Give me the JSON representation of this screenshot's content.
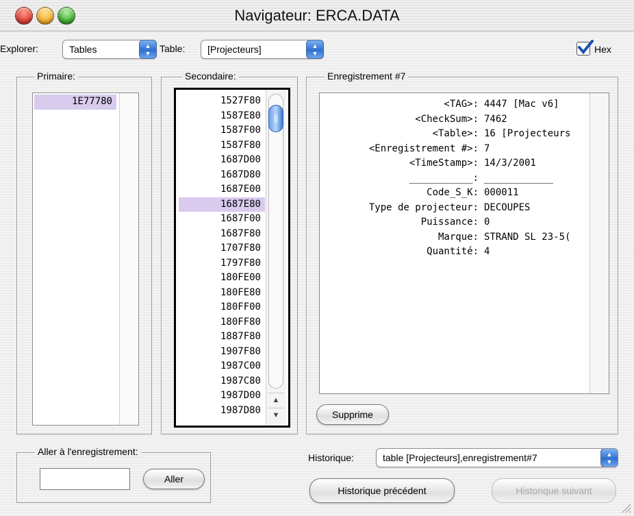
{
  "window": {
    "title": "Navigateur: ERCA.DATA"
  },
  "toolbar": {
    "explorer_label": "Explorer:",
    "explorer_value": "Tables",
    "table_label": "Table:",
    "table_value": "[Projecteurs]",
    "hex_label": "Hex",
    "hex_checked": true
  },
  "primaire": {
    "label": "Primaire:",
    "items": [
      "1E77780"
    ],
    "selected_index": 0
  },
  "secondaire": {
    "label": "Secondaire:",
    "items": [
      "1527F80",
      "1587E80",
      "1587F00",
      "1587F80",
      "1687D00",
      "1687D80",
      "1687E00",
      "1687E80",
      "1687F00",
      "1687F80",
      "1707F80",
      "1797F80",
      "180FE00",
      "180FE80",
      "180FF00",
      "180FF80",
      "1887F80",
      "1907F80",
      "1987C00",
      "1987C80",
      "1987D00",
      "1987D80"
    ],
    "selected_index": 7
  },
  "record": {
    "label": "Enregistrement #7",
    "fields": [
      {
        "key": "<TAG>:",
        "value": "4447 [Mac v6]"
      },
      {
        "key": "<CheckSum>:",
        "value": "7462"
      },
      {
        "key": "<Table>:",
        "value": "16 [Projecteurs"
      },
      {
        "key": "<Enregistrement #>:",
        "value": "7"
      },
      {
        "key": "<TimeStamp>:",
        "value": "14/3/2001"
      },
      {
        "key": "___________:",
        "value": "____________"
      },
      {
        "key": "Code_S_K:",
        "value": "000011"
      },
      {
        "key": "Type de projecteur:",
        "value": "DECOUPES"
      },
      {
        "key": "Puissance:",
        "value": "0"
      },
      {
        "key": "Marque:",
        "value": "STRAND SL 23-5("
      },
      {
        "key": "Quantité:",
        "value": "4"
      }
    ],
    "delete_label": "Supprime"
  },
  "goto": {
    "label": "Aller à l'enregistrement:",
    "input_value": "",
    "button_label": "Aller"
  },
  "history": {
    "label": "Historique:",
    "value": "table [Projecteurs],enregistrement#7",
    "prev_label": "Historique précédent",
    "next_label": "Historique suivant"
  },
  "colors": {
    "selection": "#d8cbee",
    "accent": "#2f6fd0",
    "close": "#e0443c",
    "minimize": "#f2b233",
    "zoom": "#44b035"
  }
}
